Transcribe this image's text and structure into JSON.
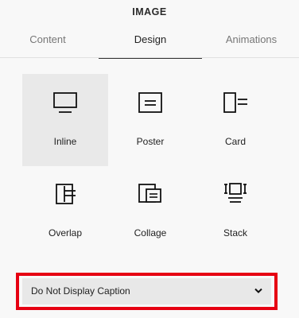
{
  "panel": {
    "title": "IMAGE"
  },
  "tabs": [
    {
      "label": "Content",
      "active": false
    },
    {
      "label": "Design",
      "active": true
    },
    {
      "label": "Animations",
      "active": false
    }
  ],
  "layouts": [
    {
      "label": "Inline",
      "icon": "inline-layout-icon",
      "selected": true
    },
    {
      "label": "Poster",
      "icon": "poster-layout-icon",
      "selected": false
    },
    {
      "label": "Card",
      "icon": "card-layout-icon",
      "selected": false
    },
    {
      "label": "Overlap",
      "icon": "overlap-layout-icon",
      "selected": false
    },
    {
      "label": "Collage",
      "icon": "collage-layout-icon",
      "selected": false
    },
    {
      "label": "Stack",
      "icon": "stack-layout-icon",
      "selected": false
    }
  ],
  "caption": {
    "selected_value": "Do Not Display Caption",
    "icon": "chevron-down-icon",
    "highlight_color": "#e60012"
  }
}
